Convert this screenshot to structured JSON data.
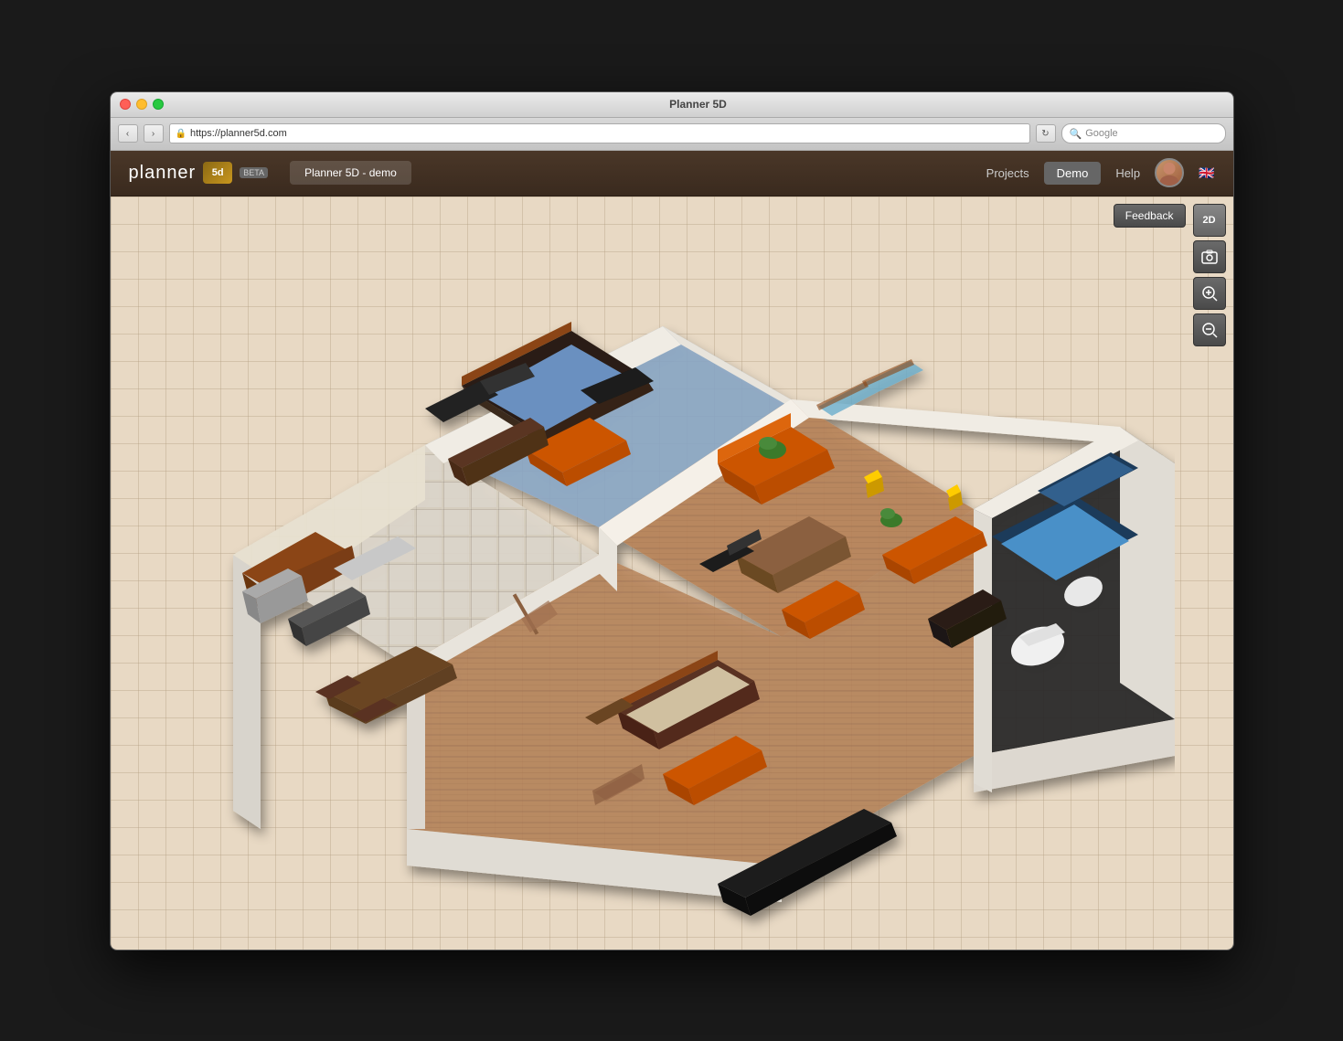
{
  "window": {
    "title": "Planner 5D"
  },
  "browser": {
    "url": "https://planner5d.com",
    "search_placeholder": "Google",
    "nav_back": "‹",
    "nav_forward": "›"
  },
  "app": {
    "logo_text": "planner",
    "logo_box": "5d",
    "beta_label": "beta",
    "project_name": "Planner 5D - demo",
    "nav_items": [
      "Projects",
      "Demo",
      "Help"
    ],
    "active_nav": "Demo",
    "flag": "🇬🇧"
  },
  "toolbar": {
    "feedback_label": "Feedback",
    "view_2d_label": "2D",
    "screenshot_icon": "📷",
    "zoom_in_icon": "🔍+",
    "zoom_out_icon": "🔍-"
  },
  "colors": {
    "header_bg": "#3a2a1e",
    "canvas_bg": "#e8d9c4",
    "grid_line": "#c8b89a",
    "wall_color": "#f0ece4",
    "wall_shadow": "#c8b89a",
    "floor_wood": "#b8845a",
    "floor_tile": "#d8cfc0",
    "floor_dark": "#8a6040",
    "furniture_orange": "#cc5500",
    "furniture_dark": "#4a3020",
    "window_blue": "#6aaecc",
    "feedback_bg": "#555"
  }
}
